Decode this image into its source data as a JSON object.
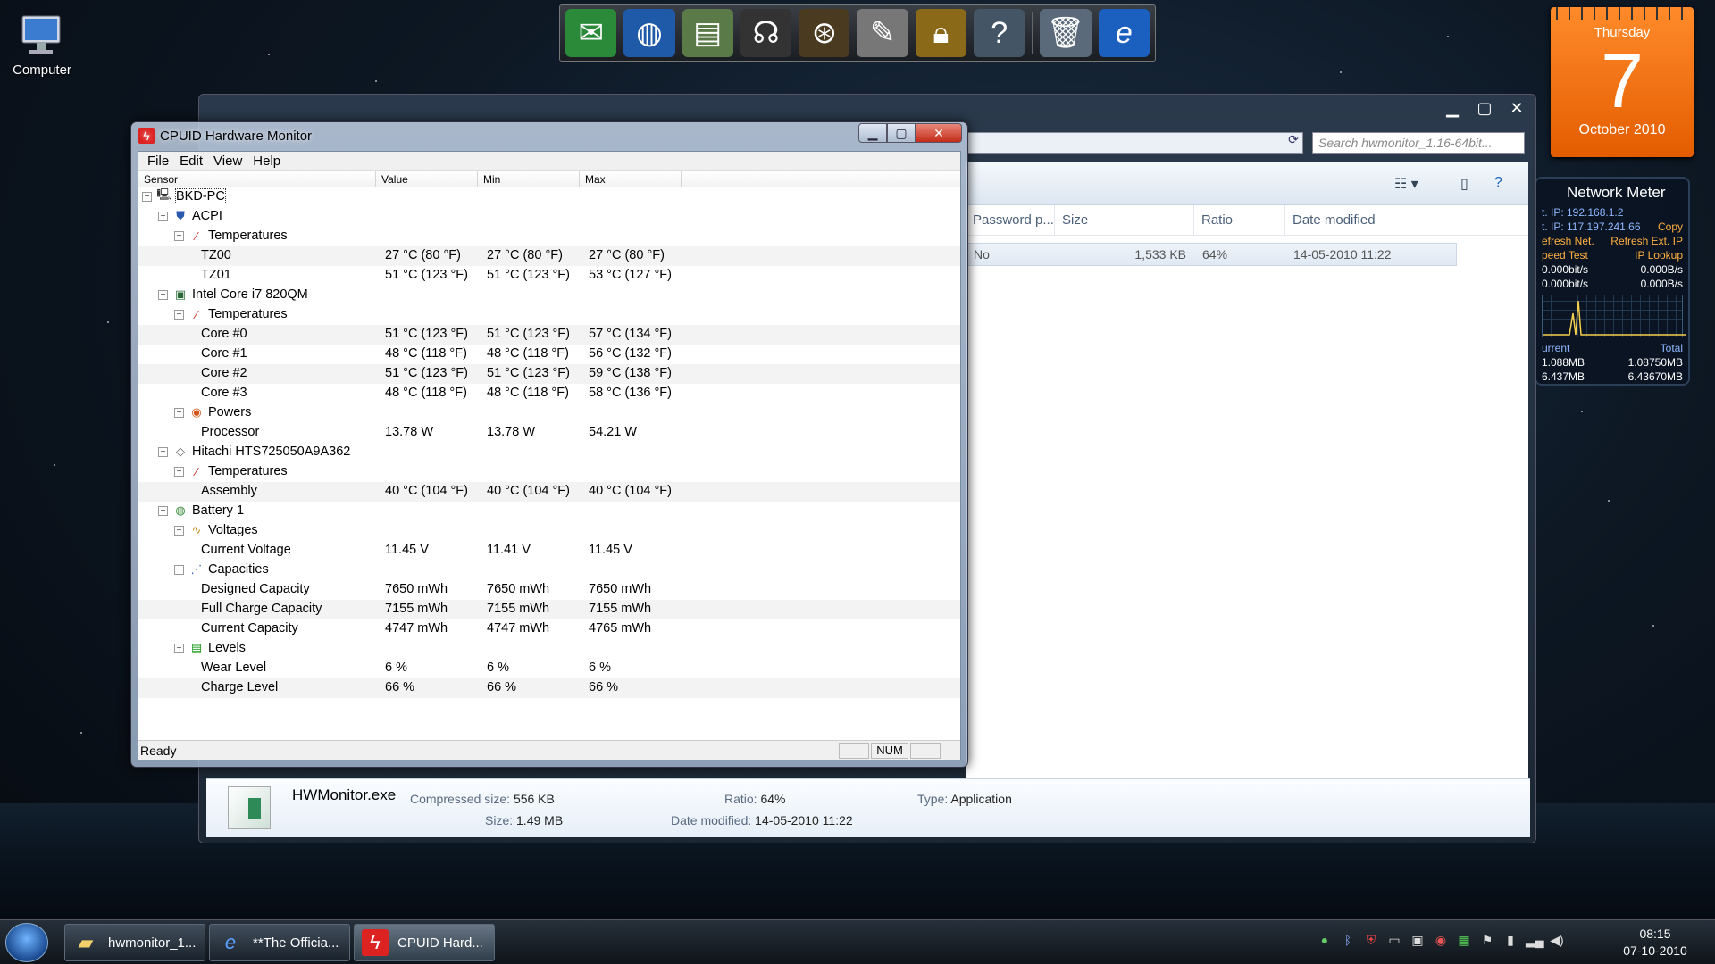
{
  "desktop": {
    "icon_label": "Computer"
  },
  "calendar": {
    "weekday": "Thursday",
    "day": "7",
    "month_year": "October 2010",
    "accent": "#f07010"
  },
  "network_meter": {
    "title": "Network Meter",
    "int_ip": "t. IP: 192.168.1.2",
    "ext_ip": "t. IP: 117.197.241.66",
    "copy": "Copy",
    "refresh_net": "efresh Net.",
    "refresh_ext": "Refresh Ext. IP",
    "speed_test": "peed Test",
    "ip_lookup": "IP Lookup",
    "up_rate": "0.000bit/s",
    "up_rate2": "0.000B/s",
    "down_rate": "0.000bit/s",
    "down_rate2": "0.000B/s",
    "current_label": "urrent",
    "total_label": "Total",
    "cur_up": "1.088MB",
    "cur_down": "6.437MB",
    "tot_up": "1.08750MB",
    "tot_down": "6.43670MB"
  },
  "explorer": {
    "search_placeholder": "Search hwmonitor_1.16-64bit...",
    "columns": [
      "Password p...",
      "Size",
      "Ratio",
      "Date modified"
    ],
    "file_row": {
      "password": "No",
      "size": "1,533 KB",
      "ratio": "64%",
      "date": "14-05-2010 11:22"
    },
    "details": {
      "name": "HWMonitor.exe",
      "compressed_label": "Compressed size:",
      "compressed": "556 KB",
      "size_label": "Size:",
      "size": "1.49 MB",
      "ratio_label": "Ratio:",
      "ratio": "64%",
      "date_label": "Date modified:",
      "date": "14-05-2010 11:22",
      "type_label": "Type:",
      "type": "Application"
    }
  },
  "hwmonitor": {
    "title": "CPUID Hardware Monitor",
    "menu": [
      "File",
      "Edit",
      "View",
      "Help"
    ],
    "columns": [
      "Sensor",
      "Value",
      "Min",
      "Max"
    ],
    "rows": [
      {
        "level": 0,
        "label": "BKD-PC",
        "icon": "computer-icon",
        "v": "",
        "mn": "",
        "mx": ""
      },
      {
        "level": 1,
        "label": "ACPI",
        "icon": "shield-icon",
        "v": "",
        "mn": "",
        "mx": ""
      },
      {
        "level": 2,
        "label": "Temperatures",
        "icon": "thermometer-icon",
        "v": "",
        "mn": "",
        "mx": ""
      },
      {
        "level": 3,
        "label": "TZ00",
        "v": "27 °C  (80 °F)",
        "mn": "27 °C  (80 °F)",
        "mx": "27 °C  (80 °F)"
      },
      {
        "level": 3,
        "label": "TZ01",
        "v": "51 °C  (123 °F)",
        "mn": "51 °C  (123 °F)",
        "mx": "53 °C  (127 °F)"
      },
      {
        "level": 1,
        "label": "Intel Core i7 820QM",
        "icon": "cpu-icon",
        "v": "",
        "mn": "",
        "mx": ""
      },
      {
        "level": 2,
        "label": "Temperatures",
        "icon": "thermometer-icon",
        "v": "",
        "mn": "",
        "mx": ""
      },
      {
        "level": 3,
        "label": "Core #0",
        "v": "51 °C  (123 °F)",
        "mn": "51 °C  (123 °F)",
        "mx": "57 °C  (134 °F)"
      },
      {
        "level": 3,
        "label": "Core #1",
        "v": "48 °C  (118 °F)",
        "mn": "48 °C  (118 °F)",
        "mx": "56 °C  (132 °F)"
      },
      {
        "level": 3,
        "label": "Core #2",
        "v": "51 °C  (123 °F)",
        "mn": "51 °C  (123 °F)",
        "mx": "59 °C  (138 °F)"
      },
      {
        "level": 3,
        "label": "Core #3",
        "v": "48 °C  (118 °F)",
        "mn": "48 °C  (118 °F)",
        "mx": "58 °C  (136 °F)"
      },
      {
        "level": 2,
        "label": "Powers",
        "icon": "power-icon",
        "v": "",
        "mn": "",
        "mx": ""
      },
      {
        "level": 3,
        "label": "Processor",
        "v": "13.78 W",
        "mn": "13.78 W",
        "mx": "54.21 W"
      },
      {
        "level": 1,
        "label": "Hitachi HTS725050A9A362",
        "icon": "harddisk-icon",
        "v": "",
        "mn": "",
        "mx": ""
      },
      {
        "level": 2,
        "label": "Temperatures",
        "icon": "thermometer-icon",
        "v": "",
        "mn": "",
        "mx": ""
      },
      {
        "level": 3,
        "label": "Assembly",
        "v": "40 °C  (104 °F)",
        "mn": "40 °C  (104 °F)",
        "mx": "40 °C  (104 °F)"
      },
      {
        "level": 1,
        "label": "Battery 1",
        "icon": "battery-icon",
        "v": "",
        "mn": "",
        "mx": ""
      },
      {
        "level": 2,
        "label": "Voltages",
        "icon": "voltage-icon",
        "v": "",
        "mn": "",
        "mx": ""
      },
      {
        "level": 3,
        "label": "Current Voltage",
        "v": "11.45 V",
        "mn": "11.41 V",
        "mx": "11.45 V"
      },
      {
        "level": 2,
        "label": "Capacities",
        "icon": "capacity-icon",
        "v": "",
        "mn": "",
        "mx": ""
      },
      {
        "level": 3,
        "label": "Designed Capacity",
        "v": "7650 mWh",
        "mn": "7650 mWh",
        "mx": "7650 mWh"
      },
      {
        "level": 3,
        "label": "Full Charge Capacity",
        "v": "7155 mWh",
        "mn": "7155 mWh",
        "mx": "7155 mWh"
      },
      {
        "level": 3,
        "label": "Current Capacity",
        "v": "4747 mWh",
        "mn": "4747 mWh",
        "mx": "4765 mWh"
      },
      {
        "level": 2,
        "label": "Levels",
        "icon": "levels-icon",
        "v": "",
        "mn": "",
        "mx": ""
      },
      {
        "level": 3,
        "label": "Wear Level",
        "v": "6 %",
        "mn": "6 %",
        "mx": "6 %"
      },
      {
        "level": 3,
        "label": "Charge Level",
        "v": "66 %",
        "mn": "66 %",
        "mx": "66 %"
      }
    ],
    "status": "Ready",
    "num_indicator": "NUM"
  },
  "taskbar": {
    "buttons": [
      {
        "label": "hwmonitor_1...",
        "icon": "folder-icon"
      },
      {
        "label": "**The Officia...",
        "icon": "ie-icon"
      },
      {
        "label": "CPUID Hard...",
        "icon": "cpuid-icon"
      }
    ],
    "time": "08:15",
    "date": "07-10-2010"
  }
}
